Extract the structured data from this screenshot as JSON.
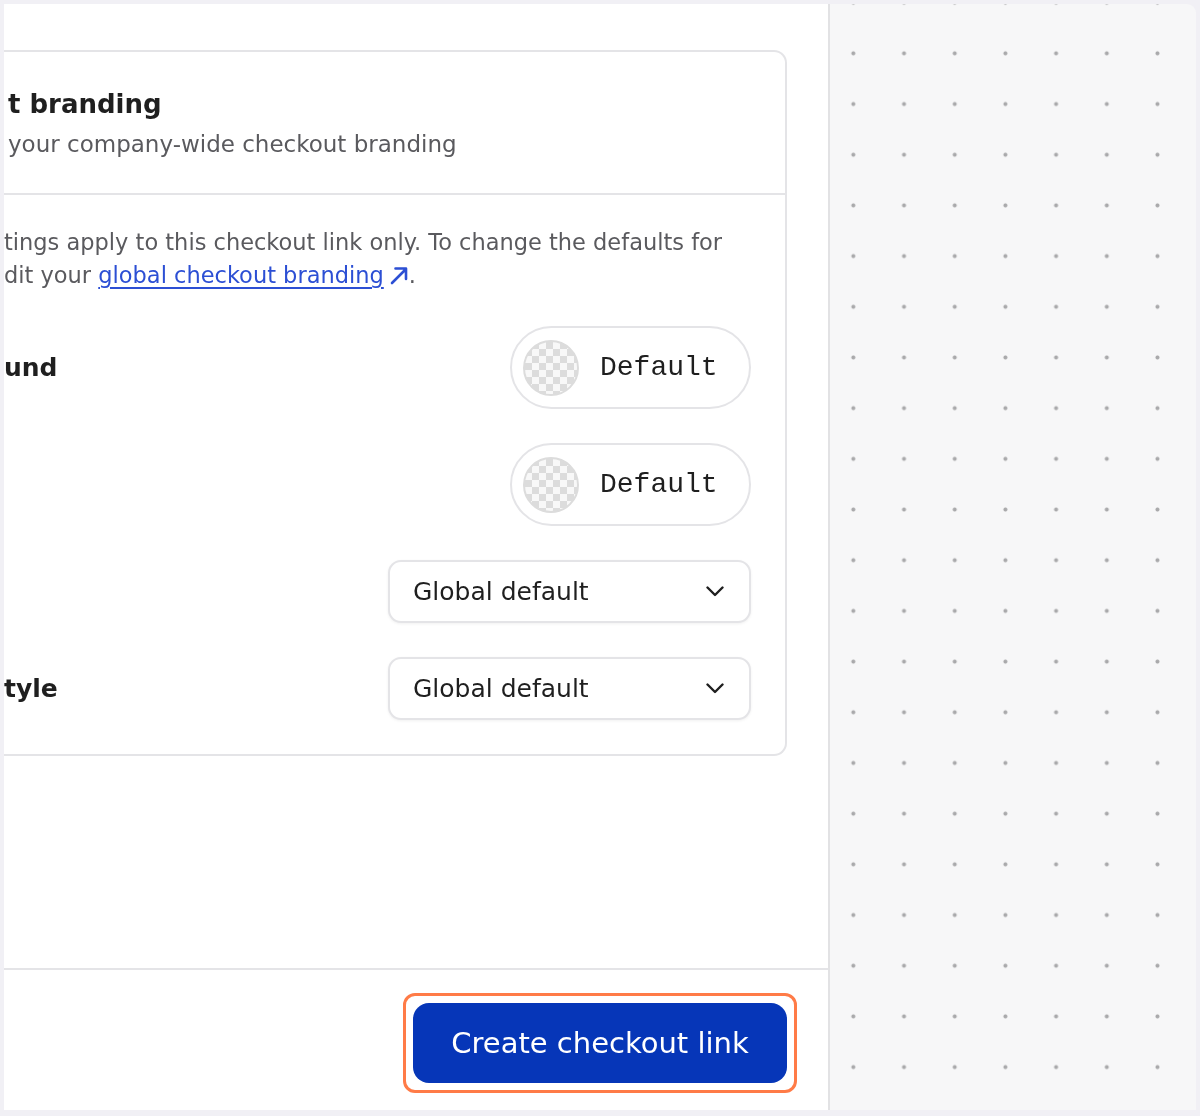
{
  "card": {
    "title": "t branding",
    "subtitle": "your company-wide checkout branding",
    "description": {
      "line_1": "tings apply to this checkout link only. To change the defaults for",
      "line_2": "dit your",
      "link": "global checkout branding",
      "end": "."
    },
    "settings": [
      {
        "kind": "color",
        "label": "und",
        "value": "Default"
      },
      {
        "kind": "color",
        "value": "Default"
      },
      {
        "kind": "select",
        "value": "Global default"
      },
      {
        "kind": "select",
        "label": "tyle",
        "value": "Global default"
      }
    ]
  },
  "footer": {
    "primary_button": {
      "label": "Create checkout link",
      "focused": true
    }
  }
}
